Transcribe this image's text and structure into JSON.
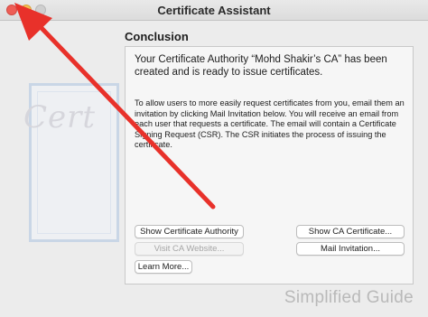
{
  "window": {
    "title": "Certificate Assistant"
  },
  "content": {
    "heading": "Conclusion",
    "paragraph1": "Your Certificate Authority “Mohd Shakir’s CA” has been created and is ready to issue certificates.",
    "paragraph2": "To allow users to more easily request certificates from you, email them an invitation by clicking Mail Invitation below. You will receive an email from each user that requests a certificate. The email will contain a Certificate Signing Request (CSR). The CSR initiates the process of issuing the certificate."
  },
  "buttons": {
    "show_authority": "Show Certificate Authority",
    "show_ca_certificate": "Show CA Certificate...",
    "visit_ca_website": "Visit CA Website...",
    "mail_invitation": "Mail Invitation...",
    "learn_more": "Learn More..."
  },
  "background": {
    "certificate_script": "Cert"
  },
  "watermark": "Simplified Guide",
  "icons": {
    "close": "close-button-icon",
    "minimize": "minimize-button-icon",
    "zoom": "zoom-button-icon",
    "annotation": "red-arrow-icon"
  },
  "colors": {
    "close": "#ee5d55",
    "minimize": "#f5bd4f",
    "zoom": "#cfcfcf",
    "arrow": "#e8312a"
  }
}
